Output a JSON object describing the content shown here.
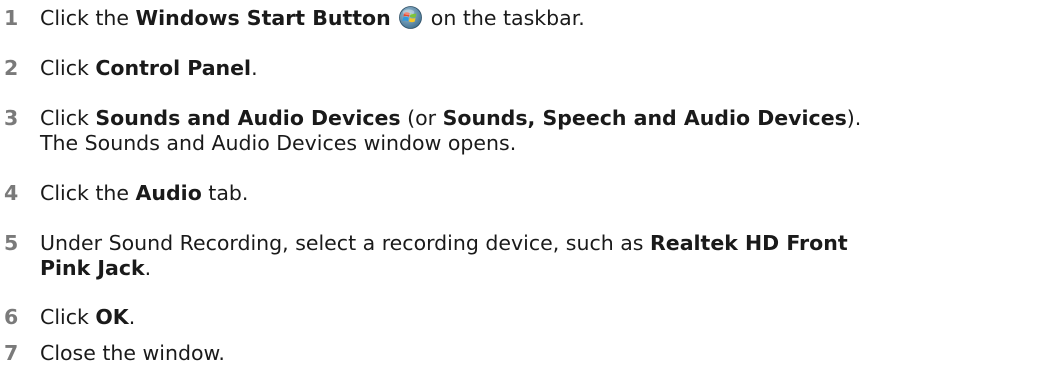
{
  "steps": [
    {
      "number": "1",
      "pre": "Click the ",
      "bold": "Windows Start Button",
      "post": " on the taskbar.",
      "icon": "windows-start-orb"
    },
    {
      "number": "2",
      "pre": "Click ",
      "bold": "Control Panel",
      "post": "."
    },
    {
      "number": "3",
      "pre": "Click ",
      "bold": "Sounds and Audio Devices",
      "mid": " (or ",
      "bold2": "Sounds, Speech and Audio Devices",
      "post": ").",
      "line2": "The Sounds and Audio Devices window opens."
    },
    {
      "number": "4",
      "pre": "Click the ",
      "bold": "Audio",
      "post": " tab."
    },
    {
      "number": "5",
      "pre": "Under Sound Recording, select a recording device, such as ",
      "bold": "Realtek HD Front",
      "line2_bold": "Pink Jack",
      "line2_post": "."
    },
    {
      "number": "6",
      "pre": "Click ",
      "bold": "OK",
      "post": "."
    },
    {
      "number": "7",
      "pre": "Close the window."
    }
  ]
}
